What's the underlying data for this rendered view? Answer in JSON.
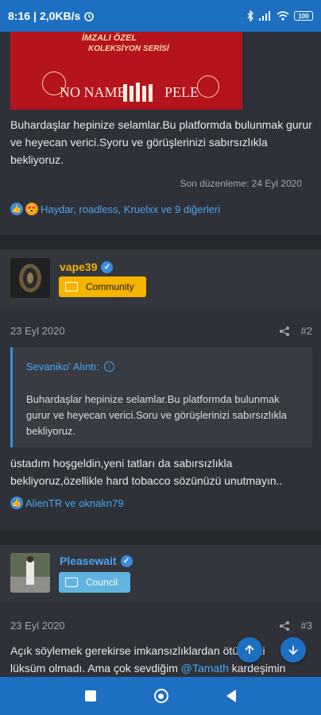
{
  "status": {
    "time": "8:16",
    "speed": "2,0KB/s",
    "battery": "100"
  },
  "post1": {
    "banner": {
      "title": "İMZALI ÖZEL",
      "subtitle": "KOLEKSİYON SERİSİ",
      "left_name": "NO NAME",
      "right_name": "PELE"
    },
    "body": "Buhardaşlar hepinize selamlar.Bu platformda bulunmak gurur ve heyecan verici.Syoru ve görüşlerinizi sabırsızlıkla bekliyoruz.",
    "edited": "Son düzenleme: 24 Eyl 2020",
    "reactions": "Haydar, roadless, Kruelxx ve 9 diğerleri"
  },
  "post2": {
    "username": "vape39",
    "badge": "Community",
    "date": "23 Eyl 2020",
    "number": "#2",
    "quote_author": "Sevaniko' Alıntı:",
    "quote_text": "Buhardaşlar hepinize selamlar.Bu platformda bulunmak gurur ve heyecan verici.Soru ve görüşlerinizi sabırsızlıkla bekliyoruz.",
    "body": "üstadım hoşgeldin,yeni tatları da sabırsızlıkla bekliyoruz,özellikle hard tobacco sözünüzü unutmayın..",
    "reactions": "AlienTR ve oknakn79"
  },
  "post3": {
    "username": "Pleasewait",
    "badge": "Council",
    "date": "23 Eyl 2020",
    "number": "#3",
    "body_start": "Açık söylemek gerekirse imkansızlıklardan ötürü kiti",
    "body_line2_a": "lüksüm olmadı. Ama çok sevdiğim ",
    "mention": "@Tamath",
    "body_line2_b": " kardeşimin"
  },
  "colors": {
    "accent": "#1d6fc2",
    "gold": "#f5b400",
    "link": "#4aa3f0",
    "background": "#2e3238"
  }
}
